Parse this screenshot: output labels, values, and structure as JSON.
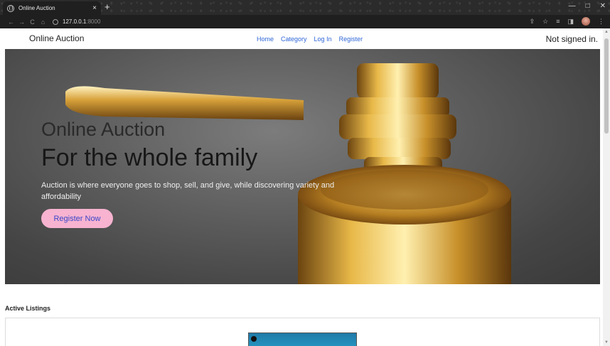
{
  "browser": {
    "tab_title": "Online Auction",
    "tab_close": "×",
    "new_tab": "+",
    "url_host": "127.0.0.1",
    "url_port": ":8000",
    "nav": {
      "back": "←",
      "forward": "→",
      "reload": "C",
      "home": "⌂"
    },
    "window_controls": {
      "minimize": "—",
      "maximize": "□",
      "close": "✕"
    },
    "toolbar_icons": {
      "share": "⇪",
      "star": "☆",
      "reading_list": "≡",
      "side_panel": "◨",
      "menu": "⋮"
    }
  },
  "navbar": {
    "brand": "Online Auction",
    "links": [
      "Home",
      "Category",
      "Log In",
      "Register"
    ],
    "status": "Not signed in."
  },
  "hero": {
    "subtitle": "Online Auction",
    "title": "For the whole family",
    "description": "Auction is where everyone goes to shop, sell, and give, while discovering variety and affordability",
    "button": "Register Now"
  },
  "listings": {
    "heading": "Active Listings"
  },
  "colors": {
    "link": "#2f67d8",
    "button_bg": "#f7b3d0",
    "button_text": "#3b46c8",
    "hero_bg": "#5e5e5e"
  }
}
